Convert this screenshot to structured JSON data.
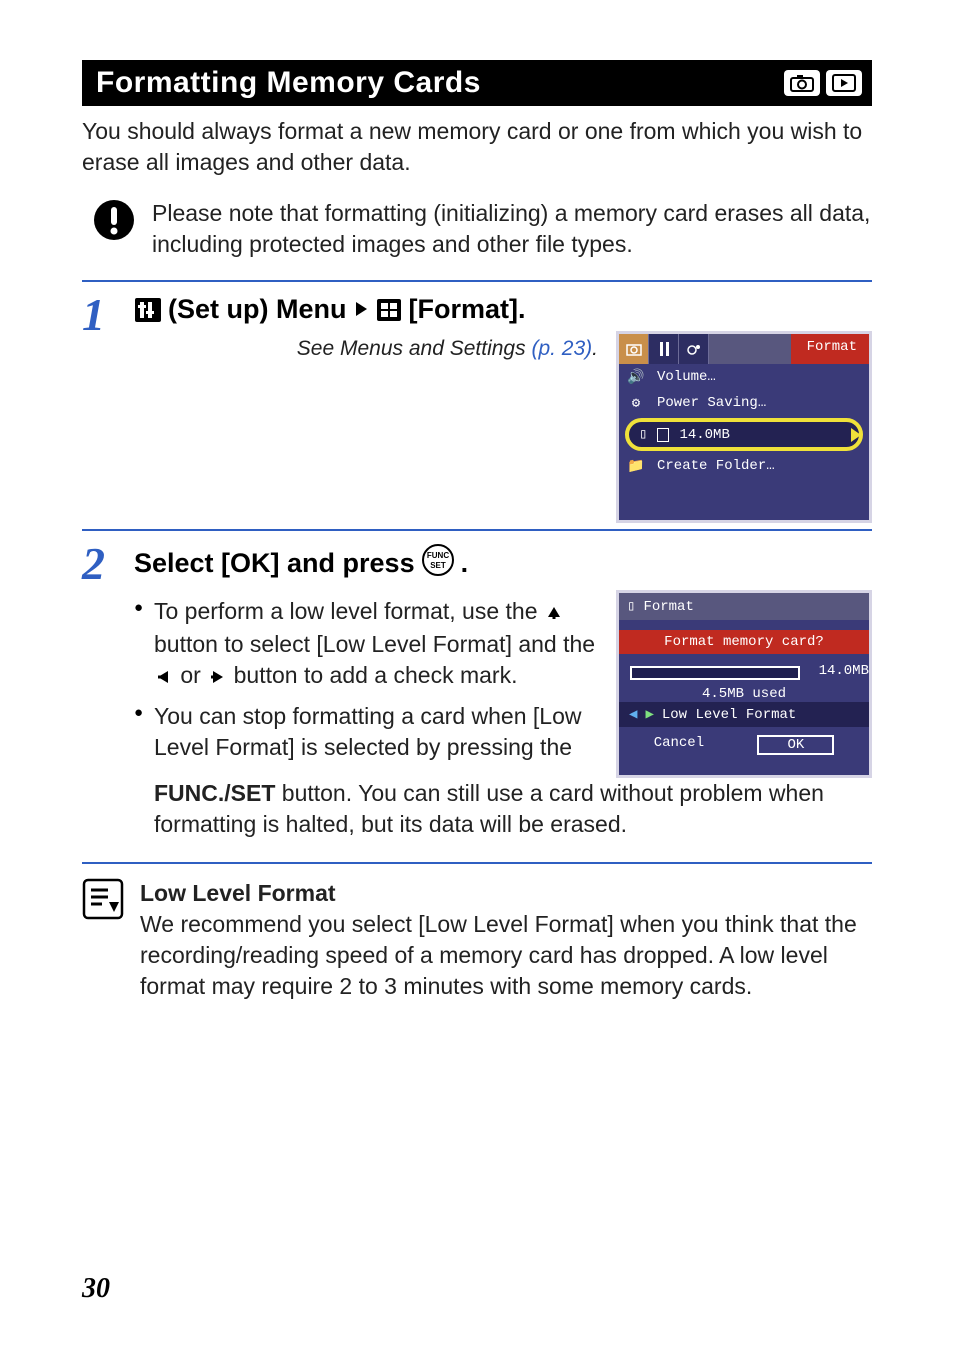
{
  "header": {
    "title": "Formatting Memory Cards"
  },
  "intro": "You should always format a new memory card or one from which you wish to erase all images and other data.",
  "caution": "Please note that formatting (initializing) a memory card erases all data, including protected images and other file types.",
  "step1": {
    "num": "1",
    "heading_prefix": " (Set up) Menu",
    "heading_suffix": "[Format].",
    "see_text": "See Menus and Settings ",
    "see_page": "(p. 23)",
    "see_dot": ".",
    "screen": {
      "fmt": "Format",
      "volume": "Volume…",
      "power": "Power Saving…",
      "size": "14.0MB",
      "create": "Create Folder…"
    }
  },
  "step2": {
    "num": "2",
    "heading": "Select [OK] and press ",
    "heading_dot": ".",
    "bullet1a": "To perform a low level format, use the ",
    "bullet1b": " button to select [Low Level Format] and the ",
    "bullet1c": " or ",
    "bullet1d": " button to add a check mark.",
    "bullet2": "You can stop formatting a card when [Low Level Format] is selected by pressing the ",
    "bullet2_btn": "FUNC./SET",
    "bullet2_tail": " button. You can still use a card without problem when formatting is halted, but its data will be erased.",
    "screen": {
      "title": "Format",
      "q": "Format memory card?",
      "total": "14.0MB",
      "used": "4.5MB used",
      "low": "Low Level Format",
      "cancel": "Cancel",
      "ok": "OK"
    }
  },
  "tip": {
    "title": "Low Level Format",
    "body": "We recommend you select [Low Level Format] when you think that the recording/reading speed of a memory card has dropped. A low level format may require 2 to 3 minutes with some memory cards."
  },
  "page": "30"
}
